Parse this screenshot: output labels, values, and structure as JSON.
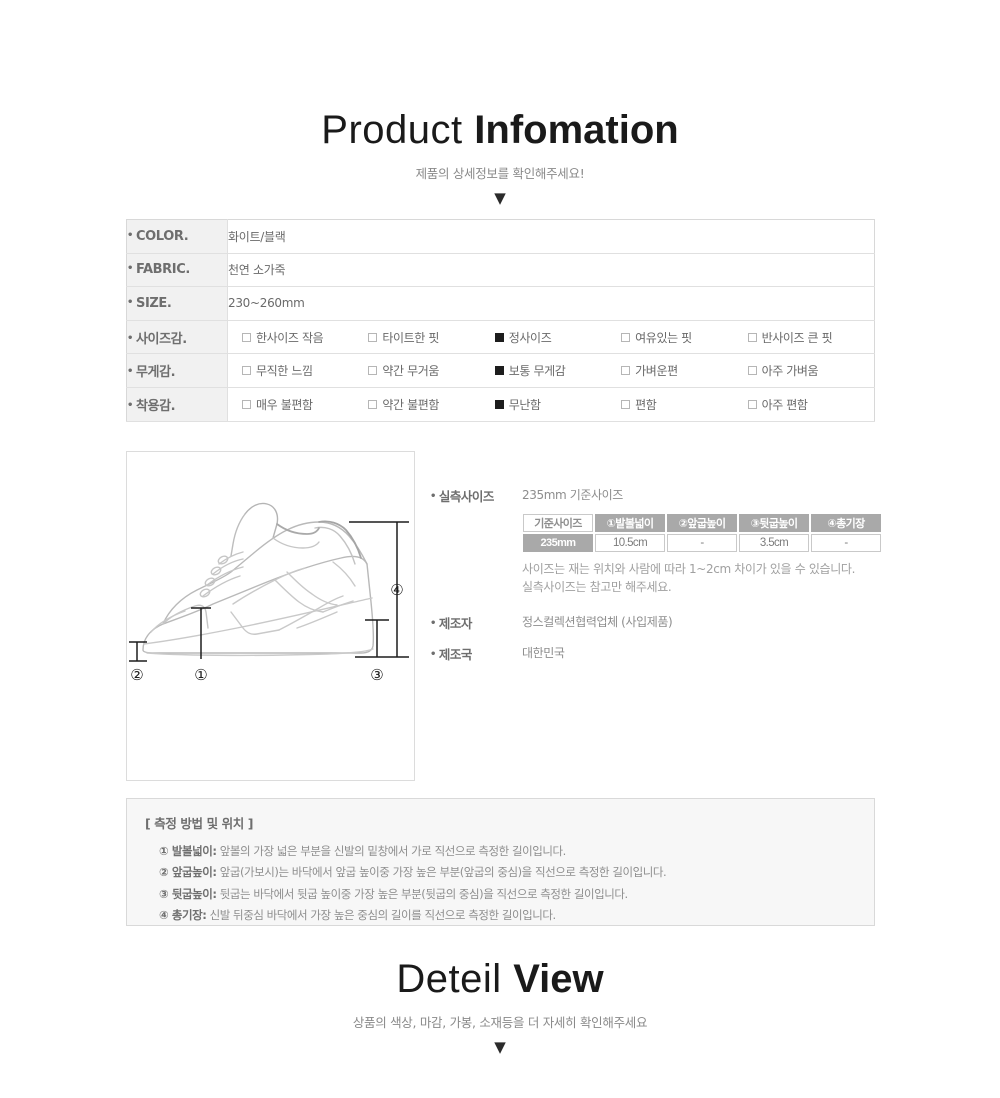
{
  "header_product": {
    "title_light": "Product ",
    "title_bold": "Infomation",
    "subtitle": "제품의 상세정보를 확인해주세요!",
    "arrow": "▼"
  },
  "header_detail": {
    "title_light": "Deteil ",
    "title_bold": "View",
    "subtitle": "상품의 색상, 마감, 가봉, 소재등을 더 자세히 확인해주세요",
    "arrow": "▼"
  },
  "spec_table": {
    "color": {
      "label": "COLOR.",
      "value": "화이트/블랙"
    },
    "fabric": {
      "label": "FABRIC.",
      "value": "천연 소가죽"
    },
    "size": {
      "label": "SIZE.",
      "value": "230~260mm"
    },
    "fit": {
      "label": "사이즈감.",
      "options": [
        {
          "text": "한사이즈 작음",
          "checked": false
        },
        {
          "text": "타이트한 핏",
          "checked": false
        },
        {
          "text": "정사이즈",
          "checked": true
        },
        {
          "text": "여유있는 핏",
          "checked": false
        },
        {
          "text": "반사이즈 큰 핏",
          "checked": false
        }
      ]
    },
    "weight": {
      "label": "무게감.",
      "options": [
        {
          "text": "무직한 느낌",
          "checked": false
        },
        {
          "text": "약간 무거움",
          "checked": false
        },
        {
          "text": "보통 무게감",
          "checked": true
        },
        {
          "text": "가벼운편",
          "checked": false
        },
        {
          "text": "아주 가벼움",
          "checked": false
        }
      ]
    },
    "comfort": {
      "label": "착용감.",
      "options": [
        {
          "text": "매우 불편함",
          "checked": false
        },
        {
          "text": "약간 불편함",
          "checked": false
        },
        {
          "text": "무난함",
          "checked": true
        },
        {
          "text": "편함",
          "checked": false
        },
        {
          "text": "아주 편함",
          "checked": false
        }
      ]
    }
  },
  "shoe_diagram": {
    "marker_1": "①",
    "marker_2": "②",
    "marker_3": "③",
    "marker_4": "④"
  },
  "measure": {
    "actual_size_label": "실측사이즈",
    "base_size_text": "235mm 기준사이즈",
    "table": {
      "headers": [
        "기준사이즈",
        "①발볼넓이",
        "②앞굽높이",
        "③뒷굽높이",
        "④총기장"
      ],
      "values": [
        "235mm",
        "10.5cm",
        "-",
        "3.5cm",
        "-"
      ]
    },
    "note_line1": "사이즈는 재는 위치와 사람에 따라 1~2cm 차이가 있을 수 있습니다.",
    "note_line2": "실측사이즈는 참고만 해주세요.",
    "maker_label": "제조자",
    "maker_value": "정스컬렉션협력업체 (사입제품)",
    "country_label": "제조국",
    "country_value": "대한민국"
  },
  "notes": {
    "title": "[ 측정 방법 및 위치 ]",
    "items": [
      {
        "key": "① 발볼넓이:",
        "text": " 앞볼의 가장 넓은 부분을 신발의 밑창에서 가로 직선으로 측정한 길이입니다."
      },
      {
        "key": "② 앞굽높이:",
        "text": " 앞굽(가보시)는 바닥에서 앞굽 높이중 가장 높은 부분(앞굽의 중심)을 직선으로 측정한 길이입니다."
      },
      {
        "key": "③ 뒷굽높이:",
        "text": " 뒷굽는 바닥에서 뒷굽 높이중 가장 높은 부분(뒷굽의 중심)을 직선으로 측정한 길이입니다."
      },
      {
        "key": "④ 총기장:",
        "text": " 신발 뒤중심 바닥에서 가장 높은 중심의 길이를 직선으로 측정한 길이입니다."
      }
    ]
  },
  "colors": {
    "heading": "#1a1a1a",
    "label_bg": "#f1f1f1",
    "table_header_gray": "#a9a9a9",
    "note_bg": "#f7f7f7",
    "border": "#d9d9d9"
  }
}
